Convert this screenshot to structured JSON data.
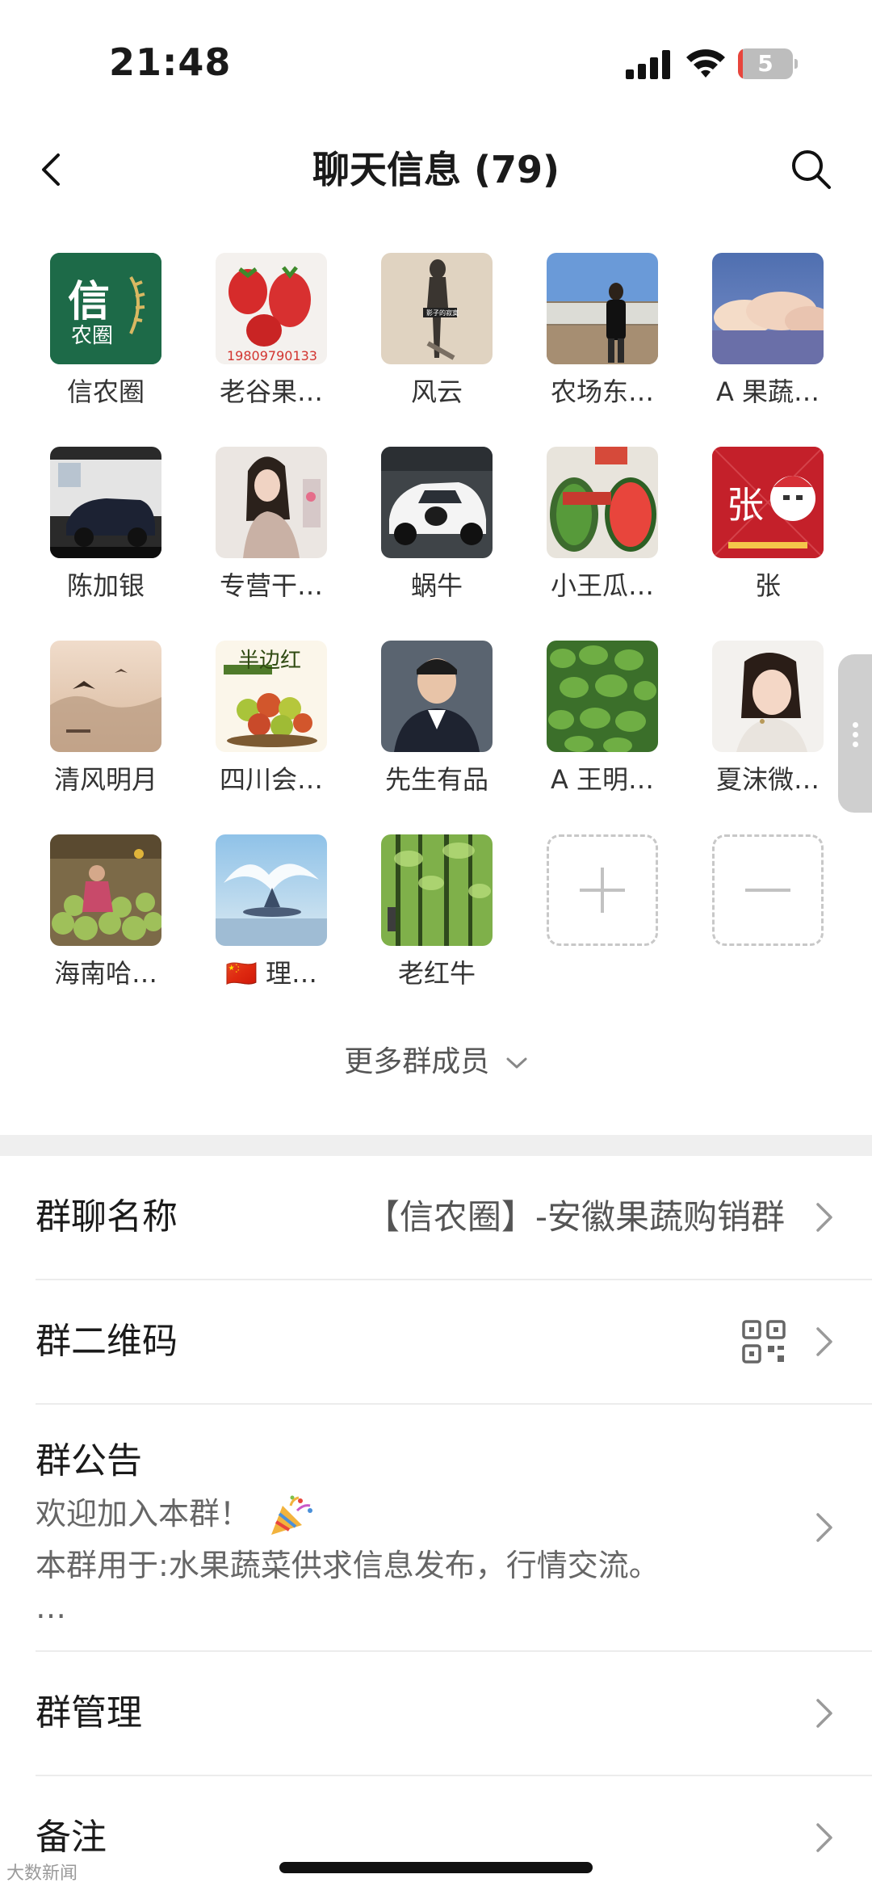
{
  "status_bar": {
    "time": "21:48",
    "battery_level": "5",
    "battery_fraction": 0.05,
    "icons": [
      "signal-icon",
      "wifi-icon",
      "battery-icon"
    ]
  },
  "nav": {
    "title": "聊天信息 (79)",
    "icons": [
      "back-icon",
      "search-icon"
    ]
  },
  "members": [
    {
      "name": "信农圈",
      "avatar_text": "信",
      "avatar_subtext": "农圈"
    },
    {
      "name": "老谷果…",
      "avatar_text": "19809790133"
    },
    {
      "name": "风云",
      "avatar_text": "影子的寂寞"
    },
    {
      "name": "农场东…"
    },
    {
      "name": "A 果蔬…"
    },
    {
      "name": "陈加银"
    },
    {
      "name": "专营干…"
    },
    {
      "name": "蜗牛"
    },
    {
      "name": "小王瓜…"
    },
    {
      "name": "张",
      "avatar_text": "张"
    },
    {
      "name": "清风明月"
    },
    {
      "name": "四川会…",
      "avatar_text": "半边红"
    },
    {
      "name": "先生有品"
    },
    {
      "name": "A 王明…"
    },
    {
      "name": "夏沫微…"
    },
    {
      "name": "海南哈…"
    },
    {
      "name": "🇨🇳 理…"
    },
    {
      "name": "老红牛"
    }
  ],
  "more_members_label": "更多群成员",
  "settings": {
    "group_name_label": "群聊名称",
    "group_name_value": "【信农圈】-安徽果蔬购销群",
    "qr_label": "群二维码",
    "notice_label": "群公告",
    "notice_line1": "欢迎加入本群！",
    "notice_line2": "本群用于:水果蔬菜供求信息发布，行情交流。",
    "notice_line3": "…",
    "manage_label": "群管理",
    "remark_label": "备注"
  },
  "watermark": "大数新闻"
}
